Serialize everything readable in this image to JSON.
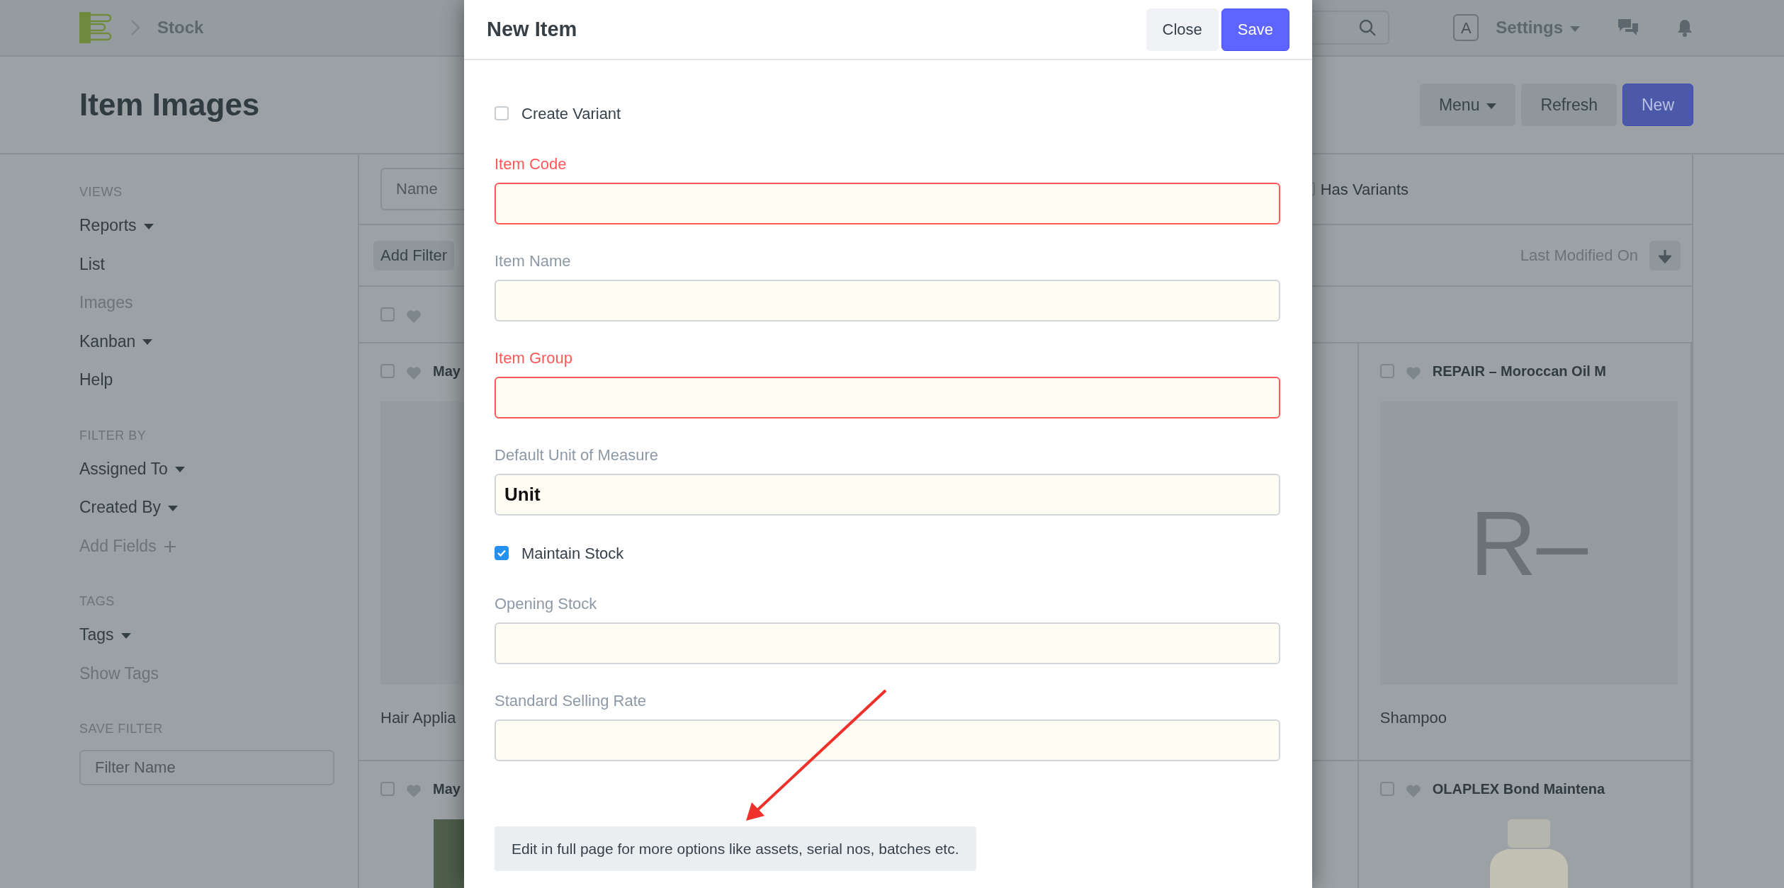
{
  "navbar": {
    "breadcrumb": "Stock",
    "avatar": "A",
    "settings": "Settings"
  },
  "page": {
    "title": "Item Images",
    "buttons": [
      {
        "label": "Menu",
        "kind": "dropdown"
      },
      {
        "label": "Refresh",
        "kind": "default"
      },
      {
        "label": "New",
        "kind": "primary"
      }
    ]
  },
  "sidebar": {
    "sections": [
      {
        "heading": "VIEWS",
        "items": [
          {
            "label": "Reports",
            "kind": "dropdown"
          },
          {
            "label": "List",
            "kind": "link"
          },
          {
            "label": "Images",
            "kind": "muted"
          },
          {
            "label": "Kanban",
            "kind": "dropdown"
          },
          {
            "label": "Help",
            "kind": "link"
          }
        ]
      },
      {
        "heading": "FILTER BY",
        "items": [
          {
            "label": "Assigned To",
            "kind": "dropdown"
          },
          {
            "label": "Created By",
            "kind": "dropdown"
          },
          {
            "label": "Add Fields",
            "kind": "add"
          }
        ]
      },
      {
        "heading": "TAGS",
        "items": [
          {
            "label": "Tags",
            "kind": "dropdown"
          },
          {
            "label": "Show Tags",
            "kind": "muted"
          }
        ]
      }
    ],
    "save_filter": {
      "heading": "SAVE FILTER",
      "placeholder": "Filter Name"
    }
  },
  "list": {
    "name_filter": {
      "placeholder": "Name"
    },
    "has_variants": {
      "label": "Has Variants",
      "checked": false
    },
    "add_filter": "Add Filter",
    "sort": {
      "label": "Last Modified On",
      "descending": true
    },
    "header": {
      "checked": false,
      "liked": false
    },
    "card_rows": [
      {
        "cards": [
          {
            "title": "May",
            "checked": false,
            "liked": false,
            "kind": "blank",
            "caption": "Hair Applia"
          },
          {
            "title": "REPAIR – Moroccan Oil M",
            "checked": false,
            "liked": false,
            "kind": "initials",
            "initials": "R–",
            "caption": "Shampoo"
          }
        ]
      },
      {
        "cards": [
          {
            "title": "May",
            "checked": false,
            "liked": false,
            "kind": "photo"
          },
          {
            "title": "OLAPLEX Bond Maintena",
            "checked": false,
            "liked": false,
            "kind": "bottle"
          }
        ]
      }
    ]
  },
  "modal": {
    "title": "New Item",
    "buttons": [
      {
        "label": "Close",
        "kind": "secondary"
      },
      {
        "label": "Save",
        "kind": "primary"
      }
    ],
    "fields": [
      {
        "kind": "checkbox",
        "label": "Create Variant",
        "checked": false
      },
      {
        "kind": "input",
        "label": "Item Code",
        "required": true
      },
      {
        "kind": "input",
        "label": "Item Name",
        "required": false
      },
      {
        "kind": "input",
        "label": "Item Group",
        "required": true
      },
      {
        "kind": "input",
        "label": "Default Unit of Measure",
        "required": false,
        "value": "Unit"
      },
      {
        "kind": "checkbox",
        "label": "Maintain Stock",
        "checked": true
      },
      {
        "kind": "input",
        "label": "Opening Stock",
        "required": false
      },
      {
        "kind": "input",
        "label": "Standard Selling Rate",
        "required": false
      }
    ],
    "full_page_button": "Edit in full page for more options like assets, serial nos, batches etc."
  }
}
